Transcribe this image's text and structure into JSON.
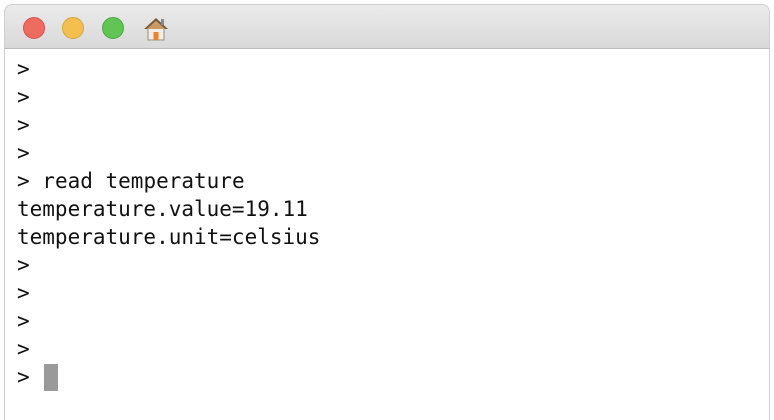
{
  "window": {
    "home_icon": "home-icon",
    "colors": {
      "close": "#ee6b5f",
      "minimize": "#f5bf4f",
      "zoom": "#61c554"
    }
  },
  "terminal": {
    "prompt": ">",
    "lines": [
      {
        "prompt": ">",
        "text": ""
      },
      {
        "prompt": ">",
        "text": ""
      },
      {
        "prompt": ">",
        "text": ""
      },
      {
        "prompt": ">",
        "text": ""
      },
      {
        "prompt": ">",
        "text": " read temperature"
      },
      {
        "prompt": "",
        "text": "temperature.value=19.11"
      },
      {
        "prompt": "",
        "text": "temperature.unit=celsius"
      },
      {
        "prompt": ">",
        "text": ""
      },
      {
        "prompt": ">",
        "text": ""
      },
      {
        "prompt": ">",
        "text": ""
      },
      {
        "prompt": ">",
        "text": ""
      },
      {
        "prompt": ">",
        "text": ""
      }
    ],
    "input_value": ""
  }
}
